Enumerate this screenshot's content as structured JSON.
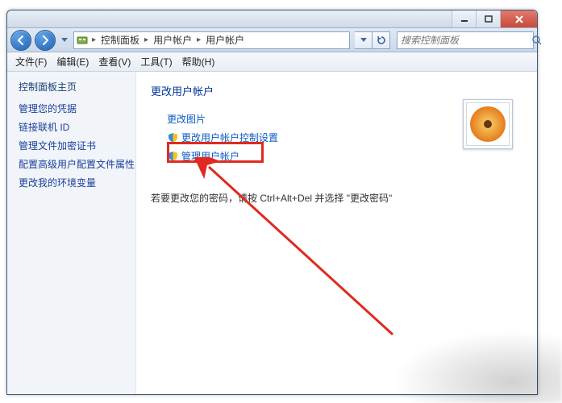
{
  "titlebar": {
    "min": "",
    "max": "",
    "close": ""
  },
  "nav": {
    "breadcrumbs": [
      "控制面板",
      "用户帐户",
      "用户帐户"
    ],
    "search_placeholder": "搜索控制面板"
  },
  "menu": {
    "file": "文件(F)",
    "edit": "编辑(E)",
    "view": "查看(V)",
    "tools": "工具(T)",
    "help": "帮助(H)"
  },
  "sidebar": {
    "home": "控制面板主页",
    "items": [
      "管理您的凭据",
      "链接联机 ID",
      "管理文件加密证书",
      "配置高级用户配置文件属性",
      "更改我的环境变量"
    ]
  },
  "content": {
    "heading": "更改用户帐户",
    "links": {
      "change_picture": "更改图片",
      "uac_settings": "更改用户帐户控制设置",
      "manage_accounts": "管理用户帐户"
    },
    "note": "若要更改您的密码，请按 Ctrl+Alt+Del 并选择 \"更改密码\""
  }
}
